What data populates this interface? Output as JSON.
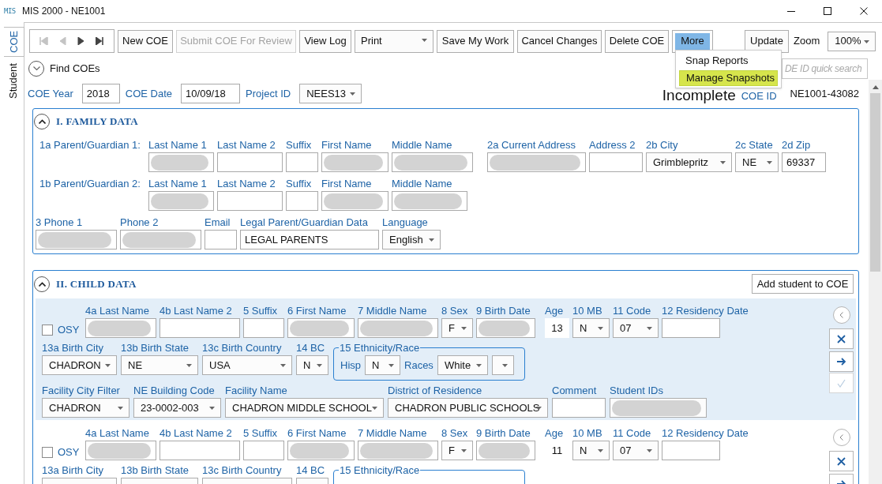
{
  "window": {
    "icon_text": "MIS",
    "title": "MIS 2000 - NE1001"
  },
  "side_tabs": [
    {
      "label": "COE",
      "selected": true
    },
    {
      "label": "Student",
      "selected": false
    }
  ],
  "toolbar": {
    "nav": [
      {
        "kind": "first",
        "disabled": true
      },
      {
        "kind": "previous",
        "disabled": true
      },
      {
        "kind": "next",
        "disabled": false
      },
      {
        "kind": "last",
        "disabled": false
      }
    ],
    "items": [
      {
        "kind": "button",
        "label": "New COE",
        "disabled": false
      },
      {
        "kind": "button",
        "label": "Submit COE For Review",
        "disabled": true
      },
      {
        "kind": "button",
        "label": "View Log",
        "disabled": false
      },
      {
        "kind": "dropdown",
        "label": "Print",
        "disabled": false
      },
      {
        "kind": "button",
        "label": "Save My Work",
        "disabled": false
      },
      {
        "kind": "button",
        "label": "Cancel Changes",
        "disabled": false
      },
      {
        "kind": "button",
        "label": "Delete COE",
        "disabled": false
      },
      {
        "kind": "menu",
        "label": "More",
        "disabled": false,
        "open": true
      }
    ],
    "update": "Update",
    "zoom_label": "Zoom",
    "zoom": "100%"
  },
  "more_menu": [
    {
      "label": "Snap Reports",
      "highlighted": false
    },
    {
      "label": "Manage Snapshots",
      "highlighted": true
    }
  ],
  "find": {
    "label": "Find COEs",
    "expanded": false
  },
  "quick_search": {
    "placeholder": "DE ID quick search"
  },
  "header": {
    "fields": [
      {
        "label": "COE Year",
        "kind": "text",
        "value": "2018"
      },
      {
        "label": "COE Date",
        "kind": "text",
        "value": "10/09/18"
      },
      {
        "label": "Project ID",
        "kind": "select",
        "value": "NEES13"
      }
    ],
    "status": "Incomplete",
    "coe_id_label": "COE ID",
    "coe_id": "NE1001-43082"
  },
  "family": {
    "title": "I. FAMILY DATA",
    "expanded": true,
    "rows": [
      {
        "label": "1a Parent/Guardian 1:",
        "fields": [
          {
            "label": "Last Name 1",
            "kind": "text",
            "redacted": true
          },
          {
            "label": "Last Name 2",
            "kind": "text",
            "redacted": false
          },
          {
            "label": "Suffix",
            "kind": "text",
            "redacted": false
          },
          {
            "label": "First Name",
            "kind": "text",
            "redacted": true
          },
          {
            "label": "Middle Name",
            "kind": "text",
            "redacted": true
          },
          {
            "label": "2a Current Address",
            "kind": "text",
            "redacted": true
          },
          {
            "label": "Address 2",
            "kind": "text",
            "redacted": false
          },
          {
            "label": "2b City",
            "kind": "select",
            "value": "Grimblepritz",
            "redacted": false
          },
          {
            "label": "2c State",
            "kind": "select",
            "value": "NE",
            "redacted": false
          },
          {
            "label": "2d Zip",
            "kind": "text",
            "value": "69337",
            "redacted": false
          }
        ]
      },
      {
        "label": "1b Parent/Guardian 2:",
        "fields": [
          {
            "label": "Last Name 1",
            "kind": "text",
            "redacted": true
          },
          {
            "label": "Last Name 2",
            "kind": "text",
            "redacted": false
          },
          {
            "label": "Suffix",
            "kind": "text",
            "redacted": false
          },
          {
            "label": "First Name",
            "kind": "text",
            "redacted": true
          },
          {
            "label": "Middle Name",
            "kind": "text",
            "redacted": true
          }
        ]
      },
      {
        "fields": [
          {
            "label": "3 Phone 1",
            "kind": "text",
            "redacted": true
          },
          {
            "label": "Phone 2",
            "kind": "text",
            "redacted": true
          },
          {
            "label": "Email",
            "kind": "text",
            "redacted": false
          },
          {
            "label": "Legal Parent/Guardian Data",
            "kind": "text",
            "value": "LEGAL PARENTS",
            "redacted": false
          },
          {
            "label": "Language",
            "kind": "select",
            "value": "English",
            "redacted": false
          }
        ]
      }
    ]
  },
  "child": {
    "title": "II. CHILD DATA",
    "expanded": true,
    "add_button": "Add student to COE",
    "students": [
      {
        "highlighted": true,
        "osy": {
          "label": "OSY",
          "checked": false
        },
        "rows": [
          {
            "fields": [
              {
                "label": "4a Last Name",
                "kind": "text",
                "redacted": true
              },
              {
                "label": "4b Last Name 2",
                "kind": "text",
                "redacted": false
              },
              {
                "label": "5 Suffix",
                "kind": "text",
                "redacted": false
              },
              {
                "label": "6 First Name",
                "kind": "text",
                "redacted": true
              },
              {
                "label": "7 Middle Name",
                "kind": "text",
                "redacted": true
              },
              {
                "label": "8 Sex",
                "kind": "select",
                "value": "F",
                "redacted": false
              },
              {
                "label": "9 Birth Date",
                "kind": "text",
                "redacted": true
              },
              {
                "label": "Age",
                "kind": "readonly",
                "value": "13",
                "redacted": false
              },
              {
                "label": "10 MB",
                "kind": "select",
                "value": "N",
                "redacted": false
              },
              {
                "label": "11 Code",
                "kind": "select",
                "value": "07",
                "redacted": false
              },
              {
                "label": "12 Residency Date",
                "kind": "text",
                "redacted": false
              }
            ]
          },
          {
            "fields": [
              {
                "label": "13a Birth City",
                "kind": "select",
                "value": "CHADRON",
                "redacted": false
              },
              {
                "label": "13b Birth State",
                "kind": "select",
                "value": "NE",
                "redacted": false
              },
              {
                "label": "13c Birth Country",
                "kind": "select",
                "value": "USA",
                "redacted": false
              },
              {
                "label": "14 BC",
                "kind": "select",
                "value": "N",
                "redacted": false
              },
              {
                "label": "15 Ethnicity/Race",
                "kind": "group",
                "items": [
                  {
                    "kind": "inline_label",
                    "label": "Hisp"
                  },
                  {
                    "kind": "select",
                    "value": "N",
                    "redacted": false
                  },
                  {
                    "kind": "inline_label",
                    "label": "Races"
                  },
                  {
                    "kind": "select",
                    "value": "White",
                    "redacted": false
                  },
                  {
                    "kind": "select",
                    "redacted": false
                  }
                ]
              }
            ]
          },
          {
            "fields": [
              {
                "label": "Facility City Filter",
                "kind": "select",
                "value": "CHADRON",
                "redacted": false
              },
              {
                "label": "NE Building Code",
                "kind": "select",
                "value": "23-0002-003",
                "redacted": false
              },
              {
                "label": "Facility Name",
                "kind": "select",
                "value": "CHADRON MIDDLE SCHOOL",
                "redacted": false
              },
              {
                "label": "District of Residence",
                "kind": "select",
                "value": "CHADRON PUBLIC SCHOOLS",
                "redacted": false
              },
              {
                "label": "Comment",
                "kind": "text",
                "redacted": false
              },
              {
                "label": "Student IDs",
                "kind": "select",
                "redacted": true
              }
            ]
          }
        ],
        "actions": [
          {
            "kind": "back",
            "disabled": false
          },
          {
            "kind": "remove",
            "disabled": false
          },
          {
            "kind": "next",
            "disabled": false
          },
          {
            "kind": "confirm",
            "disabled": true
          }
        ]
      },
      {
        "highlighted": false,
        "osy": {
          "label": "OSY",
          "checked": false
        },
        "rows": [
          {
            "fields": [
              {
                "label": "4a Last Name",
                "kind": "text",
                "redacted": true
              },
              {
                "label": "4b Last Name 2",
                "kind": "text",
                "redacted": false
              },
              {
                "label": "5 Suffix",
                "kind": "text",
                "redacted": false
              },
              {
                "label": "6 First Name",
                "kind": "text",
                "redacted": true
              },
              {
                "label": "7 Middle Name",
                "kind": "text",
                "redacted": true
              },
              {
                "label": "8 Sex",
                "kind": "select",
                "value": "F",
                "redacted": false
              },
              {
                "label": "9 Birth Date",
                "kind": "text",
                "redacted": true
              },
              {
                "label": "Age",
                "kind": "readonly",
                "value": "11",
                "redacted": false
              },
              {
                "label": "10 MB",
                "kind": "select",
                "value": "N",
                "redacted": false
              },
              {
                "label": "11 Code",
                "kind": "select",
                "value": "07",
                "redacted": false
              },
              {
                "label": "12 Residency Date",
                "kind": "text",
                "redacted": false
              }
            ]
          },
          {
            "fields": [
              {
                "label": "13a Birth City",
                "kind": "select",
                "redacted": false
              },
              {
                "label": "13b Birth State",
                "kind": "select",
                "redacted": false
              },
              {
                "label": "13c Birth Country",
                "kind": "select",
                "redacted": false
              },
              {
                "label": "14 BC",
                "kind": "select",
                "redacted": false
              },
              {
                "label": "15 Ethnicity/Race",
                "kind": "group"
              }
            ]
          }
        ],
        "actions": [
          {
            "kind": "back",
            "disabled": false
          },
          {
            "kind": "remove",
            "disabled": false
          },
          {
            "kind": "next",
            "disabled": false
          }
        ]
      }
    ]
  }
}
